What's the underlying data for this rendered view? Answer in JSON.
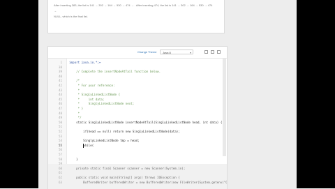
{
  "problem": {
    "lines": [
      "After inserting 383, the list is 141 → 302 → 164 → 530 → 474 → . After inserting 474, the list is 141 → 302 → 164 → 530 → 474 →",
      "NULL, which is the final list."
    ]
  },
  "toolbar": {
    "change_theme_label": "Change Theme",
    "language_value": "Java 8",
    "icons": [
      "settings-icon",
      "expand-icon",
      "fullscreen-icon"
    ]
  },
  "code": {
    "lines": [
      {
        "n": "1",
        "text": "import java.io.*;↔",
        "cls": "c-blue"
      },
      {
        "n": "38",
        "text": "",
        "cls": ""
      },
      {
        "n": "39",
        "text": "    // Complete the insertNodeAtTail function below.",
        "cls": "c-comment"
      },
      {
        "n": "40",
        "text": "",
        "cls": ""
      },
      {
        "n": "41",
        "text": "    /*",
        "cls": "c-comment"
      },
      {
        "n": "42",
        "text": "     * For your reference:",
        "cls": "c-comment"
      },
      {
        "n": "43",
        "text": "     *",
        "cls": "c-comment"
      },
      {
        "n": "44",
        "text": "     * SinglyLinkedListNode {",
        "cls": "c-comment"
      },
      {
        "n": "45",
        "text": "     *     int data;",
        "cls": "c-comment"
      },
      {
        "n": "46",
        "text": "     *     SinglyLinkedListNode next;",
        "cls": "c-comment"
      },
      {
        "n": "47",
        "text": "     * }",
        "cls": "c-comment"
      },
      {
        "n": "48",
        "text": "     *",
        "cls": "c-comment"
      },
      {
        "n": "49",
        "text": "     */",
        "cls": "c-comment"
      },
      {
        "n": "50",
        "text": "    static SinglyLinkedListNode insertNodeAtTail(SinglyLinkedListNode head, int data) {",
        "cls": ""
      },
      {
        "n": "51",
        "text": "",
        "cls": ""
      },
      {
        "n": "52",
        "text": "        if(head == null) return new SinglyLinkedListNode(data);",
        "cls": ""
      },
      {
        "n": "53",
        "text": "",
        "cls": ""
      },
      {
        "n": "54",
        "text": "        SinglyLinkedListNode tmp = head;",
        "cls": ""
      },
      {
        "n": "55",
        "text": "        while(",
        "cls": ""
      },
      {
        "n": "56",
        "text": "",
        "cls": ""
      },
      {
        "n": "57",
        "text": "",
        "cls": ""
      },
      {
        "n": "58",
        "text": "    }",
        "cls": ""
      },
      {
        "n": "59",
        "text": "",
        "cls": ""
      },
      {
        "n": "60",
        "text": "    private static final Scanner scanner = new Scanner(System.in);",
        "cls": "c-lock"
      },
      {
        "n": "61",
        "text": "",
        "cls": ""
      },
      {
        "n": "62",
        "text": "    public static void main(String[] args) throws IOException {",
        "cls": "c-lock"
      },
      {
        "n": "63",
        "text": "        BufferedWriter bufferedWriter = new BufferedWriter(new FileWriter(System.getenv(\"OUTPUT_PATH\")));",
        "cls": "c-lock"
      }
    ]
  }
}
